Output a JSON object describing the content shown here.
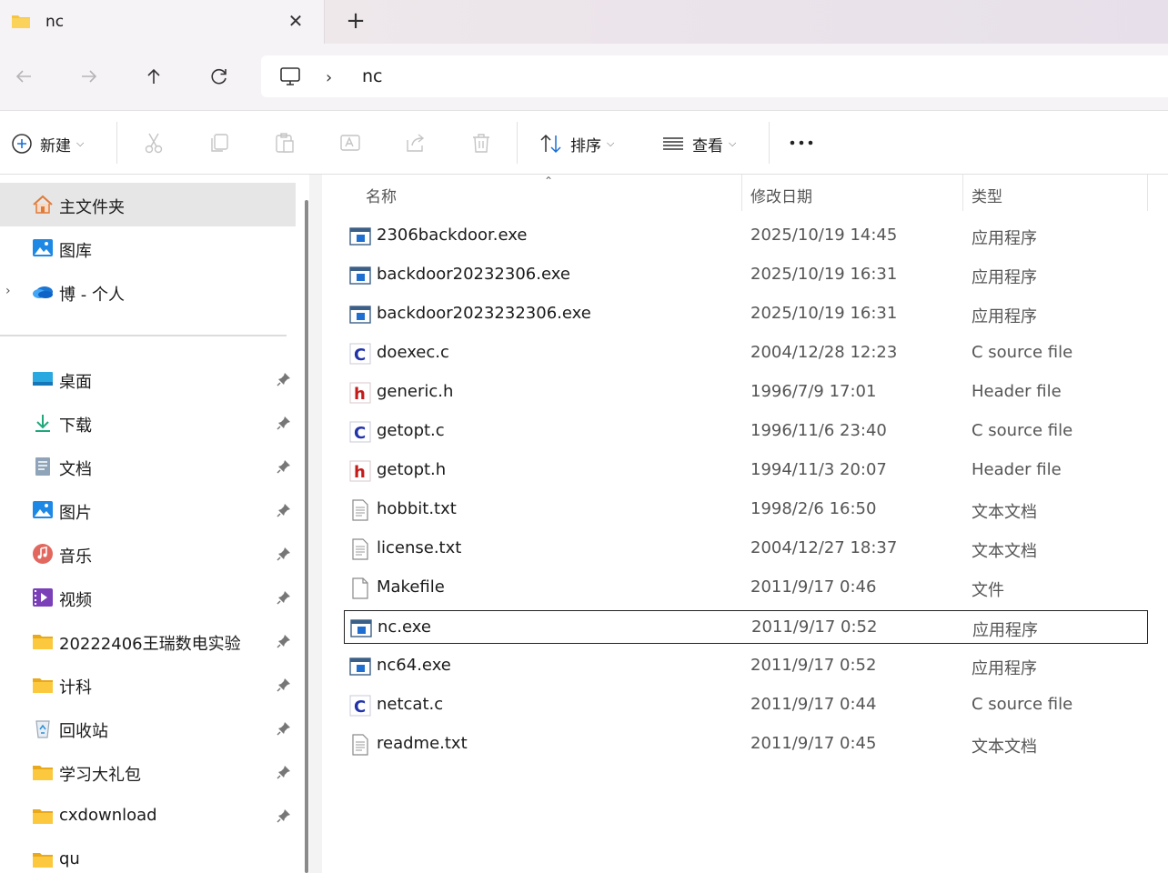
{
  "tab": {
    "title": "nc"
  },
  "address": {
    "path": [
      "nc"
    ]
  },
  "commands": {
    "new_label": "新建",
    "sort_label": "排序",
    "view_label": "查看"
  },
  "sidebar": {
    "top_items": [
      {
        "label": "主文件夹",
        "icon": "home-icon"
      },
      {
        "label": "图库",
        "icon": "gallery-icon"
      },
      {
        "label": "博 - 个人",
        "icon": "onedrive-cloud-icon"
      }
    ],
    "pinned": [
      {
        "label": "桌面",
        "icon": "desktop-icon"
      },
      {
        "label": "下载",
        "icon": "download-icon"
      },
      {
        "label": "文档",
        "icon": "documents-icon"
      },
      {
        "label": "图片",
        "icon": "pictures-icon"
      },
      {
        "label": "音乐",
        "icon": "music-icon"
      },
      {
        "label": "视频",
        "icon": "videos-icon"
      },
      {
        "label": "20222406王瑞数电实验",
        "icon": "folder-icon"
      },
      {
        "label": "计科",
        "icon": "folder-icon"
      },
      {
        "label": "回收站",
        "icon": "recycle-bin-icon"
      },
      {
        "label": "学习大礼包",
        "icon": "folder-icon"
      },
      {
        "label": "cxdownload",
        "icon": "folder-icon"
      },
      {
        "label": "qu",
        "icon": "folder-icon"
      }
    ]
  },
  "columns": {
    "name": "名称",
    "date": "修改日期",
    "type": "类型"
  },
  "files": [
    {
      "name": "2306backdoor.exe",
      "date": "2025/10/19 14:45",
      "type": "应用程序",
      "icon": "exe"
    },
    {
      "name": "backdoor20232306.exe",
      "date": "2025/10/19 16:31",
      "type": "应用程序",
      "icon": "exe"
    },
    {
      "name": "backdoor2023232306.exe",
      "date": "2025/10/19 16:31",
      "type": "应用程序",
      "icon": "exe"
    },
    {
      "name": "doexec.c",
      "date": "2004/12/28 12:23",
      "type": "C source file",
      "icon": "c"
    },
    {
      "name": "generic.h",
      "date": "1996/7/9 17:01",
      "type": "Header file",
      "icon": "h"
    },
    {
      "name": "getopt.c",
      "date": "1996/11/6 23:40",
      "type": "C source file",
      "icon": "c"
    },
    {
      "name": "getopt.h",
      "date": "1994/11/3 20:07",
      "type": "Header file",
      "icon": "h"
    },
    {
      "name": "hobbit.txt",
      "date": "1998/2/6 16:50",
      "type": "文本文档",
      "icon": "txt"
    },
    {
      "name": "license.txt",
      "date": "2004/12/27 18:37",
      "type": "文本文档",
      "icon": "txt"
    },
    {
      "name": "Makefile",
      "date": "2011/9/17 0:46",
      "type": "文件",
      "icon": "file"
    },
    {
      "name": "nc.exe",
      "date": "2011/9/17 0:52",
      "type": "应用程序",
      "icon": "exe",
      "focused": true
    },
    {
      "name": "nc64.exe",
      "date": "2011/9/17 0:52",
      "type": "应用程序",
      "icon": "exe"
    },
    {
      "name": "netcat.c",
      "date": "2011/9/17 0:44",
      "type": "C source file",
      "icon": "c"
    },
    {
      "name": "readme.txt",
      "date": "2011/9/17 0:45",
      "type": "文本文档",
      "icon": "txt"
    }
  ]
}
